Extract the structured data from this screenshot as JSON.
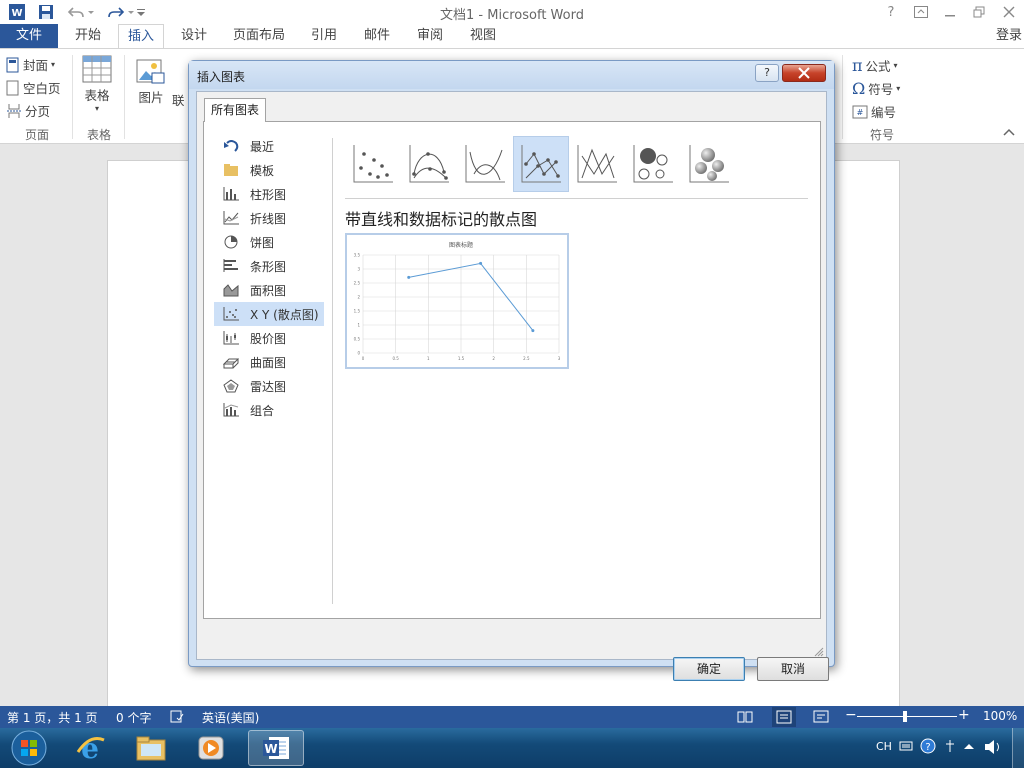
{
  "titlebar": {
    "title": "文档1 - Microsoft Word",
    "help": "?"
  },
  "tabs": {
    "file": "文件",
    "items": [
      "开始",
      "插入",
      "设计",
      "页面布局",
      "引用",
      "邮件",
      "审阅",
      "视图"
    ],
    "selected": "插入",
    "signin": "登录"
  },
  "ribbon": {
    "pages": [
      "封面",
      "空白页",
      "分页"
    ],
    "pages_group": "页面",
    "table": "表格",
    "table_group": "表格",
    "picture": "图片",
    "online": "联",
    "equation": "公式",
    "symbol": "符号",
    "number": "编号",
    "symbols_group": "符号"
  },
  "dialog": {
    "title": "插入图表",
    "help": "?",
    "tab": "所有图表",
    "chart_types": [
      {
        "label": "最近",
        "icon": "recent-icon"
      },
      {
        "label": "模板",
        "icon": "folder-icon"
      },
      {
        "label": "柱形图",
        "icon": "column-chart-icon"
      },
      {
        "label": "折线图",
        "icon": "line-chart-icon"
      },
      {
        "label": "饼图",
        "icon": "pie-chart-icon"
      },
      {
        "label": "条形图",
        "icon": "bar-chart-icon"
      },
      {
        "label": "面积图",
        "icon": "area-chart-icon"
      },
      {
        "label": "X Y (散点图)",
        "icon": "scatter-chart-icon"
      },
      {
        "label": "股价图",
        "icon": "stock-chart-icon"
      },
      {
        "label": "曲面图",
        "icon": "surface-chart-icon"
      },
      {
        "label": "雷达图",
        "icon": "radar-chart-icon"
      },
      {
        "label": "组合",
        "icon": "combo-chart-icon"
      }
    ],
    "selected_type": "X Y (散点图)",
    "subtype_icons": [
      "scatter-icon",
      "scatter-smooth-markers-icon",
      "scatter-smooth-icon",
      "scatter-straight-markers-icon",
      "scatter-straight-icon",
      "bubble-icon",
      "bubble-3d-icon"
    ],
    "selected_subtype": "scatter-straight-markers-icon",
    "subtype_title": "带直线和数据标记的散点图",
    "ok": "确定",
    "cancel": "取消"
  },
  "preview_chart": {
    "title": "图表标题",
    "y_ticks": [
      "0",
      "0.5",
      "1",
      "1.5",
      "2",
      "2.5",
      "3",
      "3.5"
    ],
    "x_ticks": [
      "0",
      "0.5",
      "1",
      "1.5",
      "2",
      "2.5",
      "3"
    ]
  },
  "chart_data": {
    "type": "scatter",
    "title": "图表标题",
    "series": [
      {
        "x": [
          0.7,
          1.8,
          2.6
        ],
        "y": [
          2.7,
          3.2,
          0.8
        ]
      }
    ],
    "xlim": [
      0,
      3
    ],
    "ylim": [
      0,
      3.5
    ],
    "grid": true,
    "lines": "straight",
    "markers": true
  },
  "statusbar": {
    "page": "第 1 页，共 1 页",
    "words": "0 个字",
    "language": "英语(美国)",
    "zoom": "100%"
  },
  "tray": {
    "ime": "CH"
  },
  "colors": {
    "accent": "#2b579a",
    "selection": "#cde0f7",
    "series": "#5b9bd5"
  }
}
